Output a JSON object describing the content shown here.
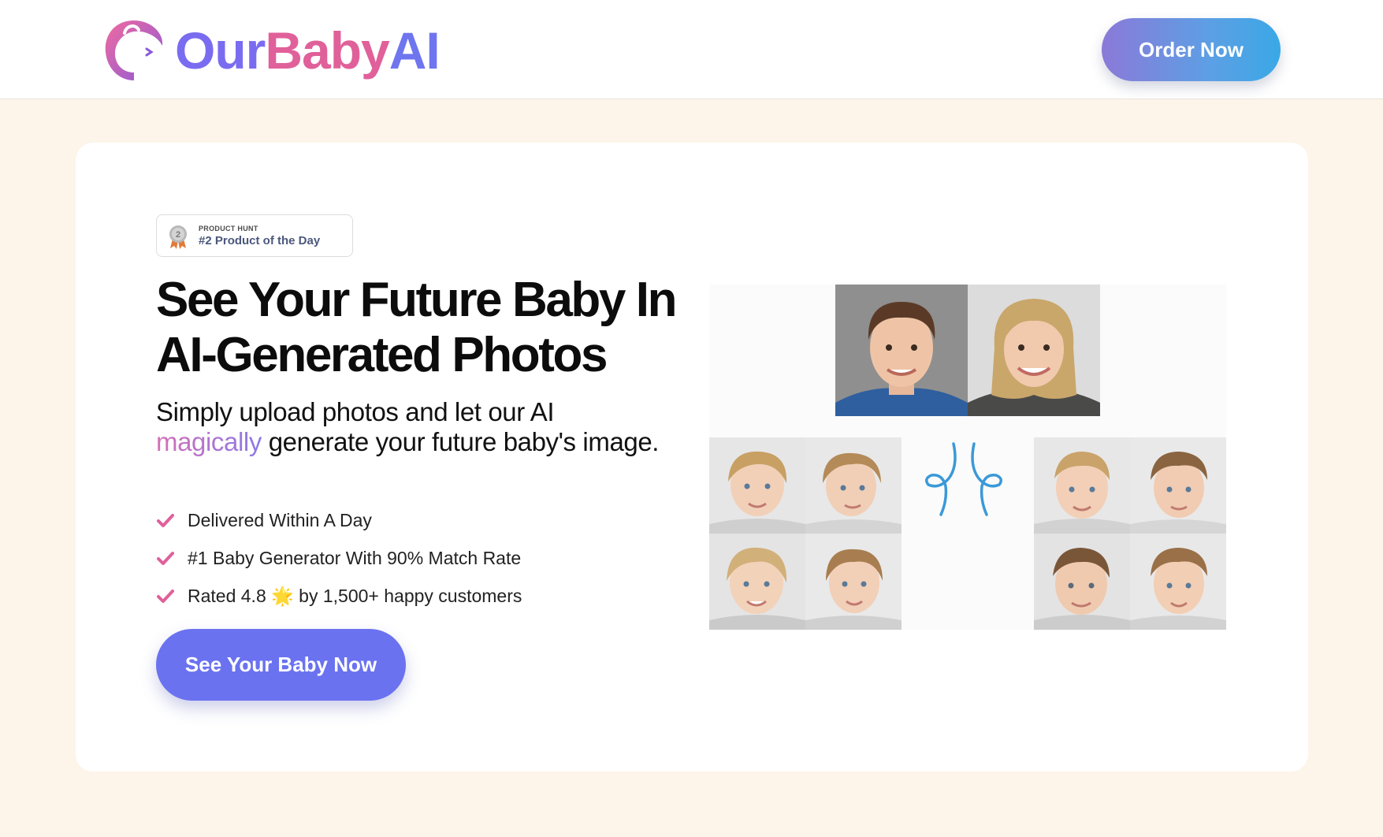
{
  "header": {
    "brand": {
      "our": "Our",
      "baby": "Baby",
      "ai": "AI"
    },
    "order_button": "Order Now"
  },
  "hero": {
    "badge": {
      "kicker": "PRODUCT HUNT",
      "title": "#2 Product of the Day",
      "rank": "2"
    },
    "headline_line1": "See Your Future Baby In",
    "headline_line2": "AI-Generated Photos",
    "sub_part1": "Simply upload photos and let our AI",
    "sub_highlight": "magically",
    "sub_part2": "generate your future baby's image.",
    "features": [
      {
        "text": "Delivered Within A Day"
      },
      {
        "text": "#1 Baby Generator With 90% Match Rate"
      },
      {
        "text_before": "Rated 4.8",
        "emoji": "🌟",
        "text_after": "by 1,500+ happy customers"
      }
    ],
    "cta_button": "See Your Baby Now"
  },
  "colors": {
    "accent_purple": "#6a72f0",
    "accent_pink": "#e0609a",
    "check_pink": "#e0609a",
    "page_bg": "#fdf4ea",
    "arrow_blue": "#3b99d8"
  },
  "icons": [
    "logo-face-icon",
    "medal-icon",
    "check-icon",
    "star-emoji"
  ]
}
